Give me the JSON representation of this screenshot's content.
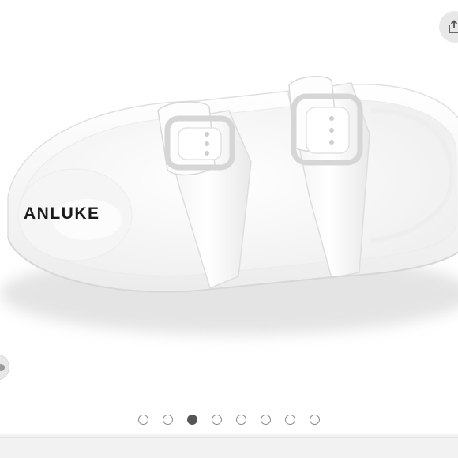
{
  "product": {
    "brand_label": "ANLUKE",
    "image_name": "white-double-buckle-slide-sandal"
  },
  "gallery": {
    "total_images": 8,
    "current_index": 3
  },
  "icons": {
    "share": "share-icon"
  },
  "colors": {
    "sandal": "#fbfbfb",
    "shadow": "#d9d9d9",
    "active_dot": "#555555",
    "inactive_dot_border": "#888888"
  }
}
